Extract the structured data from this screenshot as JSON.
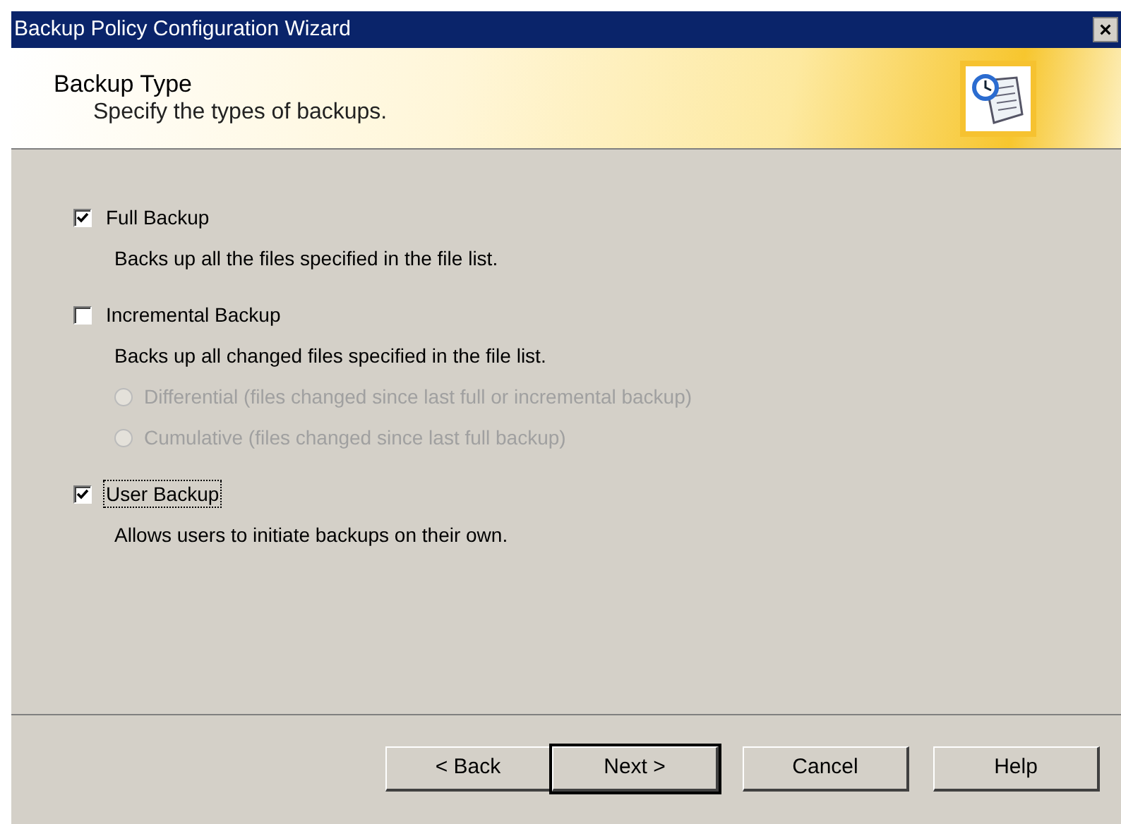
{
  "window": {
    "title": "Backup Policy Configuration Wizard",
    "close": "×"
  },
  "header": {
    "title": "Backup Type",
    "subtitle": "Specify the types of backups."
  },
  "options": [
    {
      "label": "Full Backup",
      "checked": true,
      "focused": false,
      "description": "Backs up all the files specified in the file list."
    },
    {
      "label": "Incremental Backup",
      "checked": false,
      "focused": false,
      "description": "Backs up all changed files specified in the file list.",
      "choices": [
        {
          "label": "Differential (files changed since last full or incremental backup)",
          "selected": false,
          "disabled": true
        },
        {
          "label": "Cumulative (files changed since last full backup)",
          "selected": false,
          "disabled": true
        }
      ]
    },
    {
      "label": "User Backup",
      "checked": true,
      "focused": true,
      "description": "Allows users to initiate backups on their own."
    }
  ],
  "buttons": [
    {
      "label": "< Back",
      "default": false
    },
    {
      "label": "Next >",
      "default": true
    },
    {
      "label": "Cancel",
      "default": false
    },
    {
      "label": "Help",
      "default": false
    }
  ]
}
